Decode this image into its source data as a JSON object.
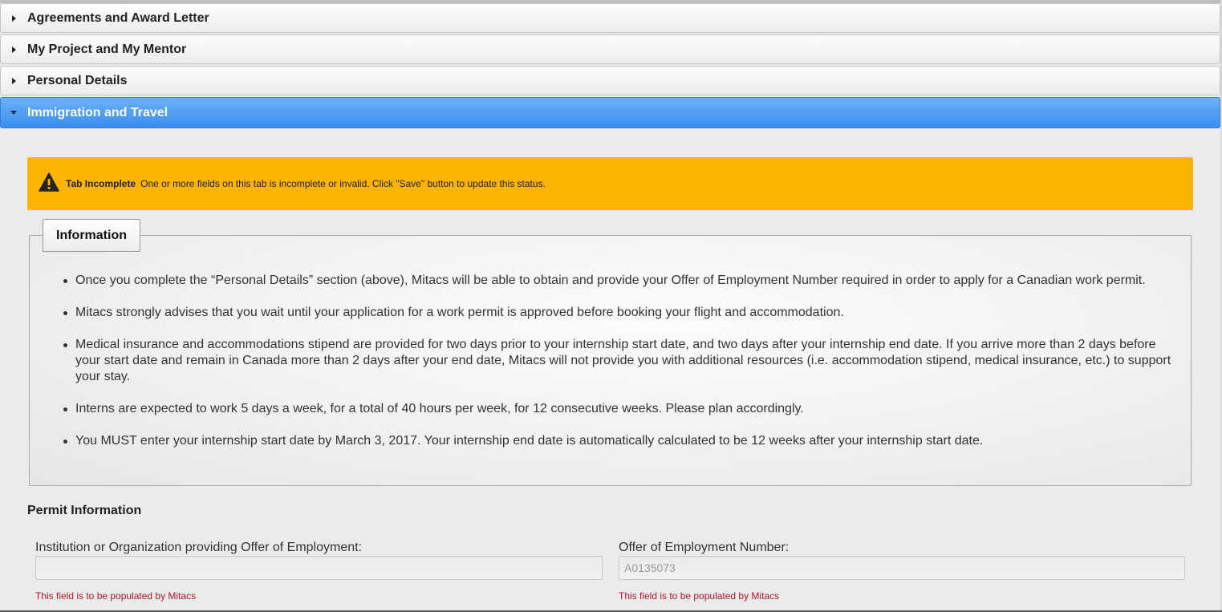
{
  "accordion": {
    "sections": [
      {
        "label": "Agreements and Award Letter"
      },
      {
        "label": "My Project and My Mentor"
      },
      {
        "label": "Personal Details"
      },
      {
        "label": "Immigration and Travel"
      }
    ]
  },
  "warning": {
    "icon": "warning-triangle-icon",
    "title": "Tab Incomplete",
    "message": "One or more fields on this tab is incomplete or invalid. Click \"Save\" button to update this status.",
    "color": "#ffb400"
  },
  "information": {
    "title": "Information",
    "items": [
      "Once you complete the “Personal Details” section (above), Mitacs will be able to obtain and provide your Offer of Employment Number required in order to apply for a Canadian work permit.",
      "Mitacs strongly advises that you wait until your application for a work permit is approved before booking your flight and accommodation.",
      "Medical insurance and accommodations stipend are provided for two days prior to your internship start date, and two days after your internship end date. If you arrive more than 2 days before your start date and remain in Canada more than 2 days after your end date, Mitacs will not provide you with additional resources (i.e. accommodation stipend, medical insurance, etc.) to support your stay.",
      "Interns are expected to work 5 days a week, for a total of 40 hours per week, for 12 consecutive weeks. Please plan accordingly.",
      "You MUST enter your internship start date by March 3, 2017. Your internship end date is automatically calculated to be 12 weeks after your internship start date."
    ]
  },
  "permit": {
    "title": "Permit Information",
    "institution": {
      "label": "Institution or Organization providing Offer of Employment:",
      "value": "",
      "hint": "This field is to be populated by Mitacs"
    },
    "offer_number": {
      "label": "Offer of Employment Number:",
      "value": "A0135073",
      "hint": "This field is to be populated by Mitacs"
    }
  },
  "colors": {
    "active_header": "#3a8ef0",
    "warning": "#ffb400",
    "hint_text": "#b0152a"
  }
}
